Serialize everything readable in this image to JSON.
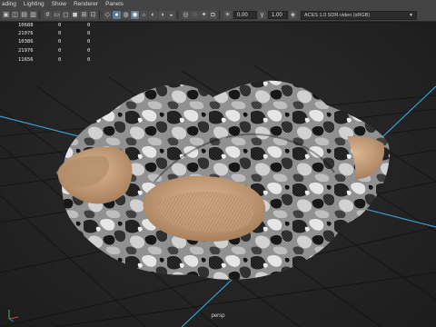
{
  "menubar": {
    "items": [
      "Shading",
      "Lighting",
      "Show",
      "Renderer",
      "Panels"
    ],
    "display": [
      "ading",
      "Lighting",
      "Show",
      "Renderer",
      "Panels"
    ]
  },
  "toolbar": {
    "exposure_value": "0.00",
    "gamma_value": "1.00",
    "color_space": "ACES 1.0 SDR-video (sRGB)"
  },
  "hud": {
    "rows": [
      [
        "10688",
        "0",
        "0"
      ],
      [
        "21076",
        "0",
        "0"
      ],
      [
        "10386",
        "0",
        "0"
      ],
      [
        "21976",
        "0",
        "0"
      ],
      [
        "11656",
        "0",
        "0"
      ]
    ]
  },
  "viewport": {
    "camera_label": "persp"
  },
  "colors": {
    "grid_axis": "#3aa6d6",
    "grid_line": "#121212",
    "footbed": "#c9a17c",
    "camo_dark": "#1e1e1e",
    "camo_light": "#cfcfcf"
  }
}
